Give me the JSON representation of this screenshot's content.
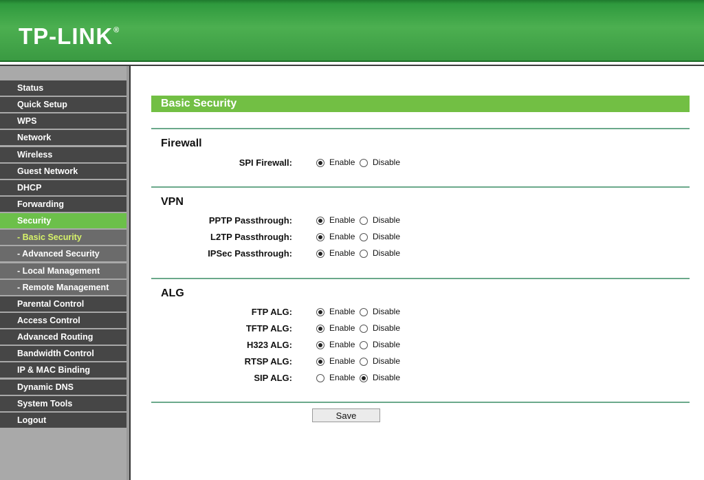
{
  "brand": {
    "logo_text": "TP-LINK",
    "registered": "®"
  },
  "sidebar": {
    "items": [
      {
        "label": "Status",
        "type": "top"
      },
      {
        "label": "Quick Setup",
        "type": "top"
      },
      {
        "label": "WPS",
        "type": "top"
      },
      {
        "label": "Network",
        "type": "top"
      },
      {
        "label": "Wireless",
        "type": "top"
      },
      {
        "label": "Guest Network",
        "type": "top"
      },
      {
        "label": "DHCP",
        "type": "top"
      },
      {
        "label": "Forwarding",
        "type": "top"
      },
      {
        "label": "Security",
        "type": "active"
      },
      {
        "label": "- Basic Security",
        "type": "current"
      },
      {
        "label": "- Advanced Security",
        "type": "sub"
      },
      {
        "label": "- Local Management",
        "type": "sub"
      },
      {
        "label": "- Remote Management",
        "type": "sub"
      },
      {
        "label": "Parental Control",
        "type": "top"
      },
      {
        "label": "Access Control",
        "type": "top"
      },
      {
        "label": "Advanced Routing",
        "type": "top"
      },
      {
        "label": "Bandwidth Control",
        "type": "top"
      },
      {
        "label": "IP & MAC Binding",
        "type": "top"
      },
      {
        "label": "Dynamic DNS",
        "type": "top"
      },
      {
        "label": "System Tools",
        "type": "top"
      },
      {
        "label": "Logout",
        "type": "top"
      }
    ]
  },
  "page": {
    "title": "Basic Security",
    "enable_label": "Enable",
    "disable_label": "Disable",
    "firewall": {
      "title": "Firewall",
      "rows": [
        {
          "label": "SPI Firewall:",
          "value": "Enable"
        }
      ]
    },
    "vpn": {
      "title": "VPN",
      "rows": [
        {
          "label": "PPTP Passthrough:",
          "value": "Enable"
        },
        {
          "label": "L2TP Passthrough:",
          "value": "Enable"
        },
        {
          "label": "IPSec Passthrough:",
          "value": "Enable"
        }
      ]
    },
    "alg": {
      "title": "ALG",
      "rows": [
        {
          "label": "FTP ALG:",
          "value": "Enable"
        },
        {
          "label": "TFTP ALG:",
          "value": "Enable"
        },
        {
          "label": "H323 ALG:",
          "value": "Enable"
        },
        {
          "label": "RTSP ALG:",
          "value": "Enable"
        },
        {
          "label": "SIP ALG:",
          "value": "Disable"
        }
      ]
    },
    "save_label": "Save"
  },
  "colors": {
    "header_green": "#3a9a42",
    "title_bar_green": "#72bf44",
    "menu_dark": "#464646",
    "menu_active": "#6cc04a",
    "menu_current_text": "#d7f36a",
    "divider": "#6aa88a"
  }
}
